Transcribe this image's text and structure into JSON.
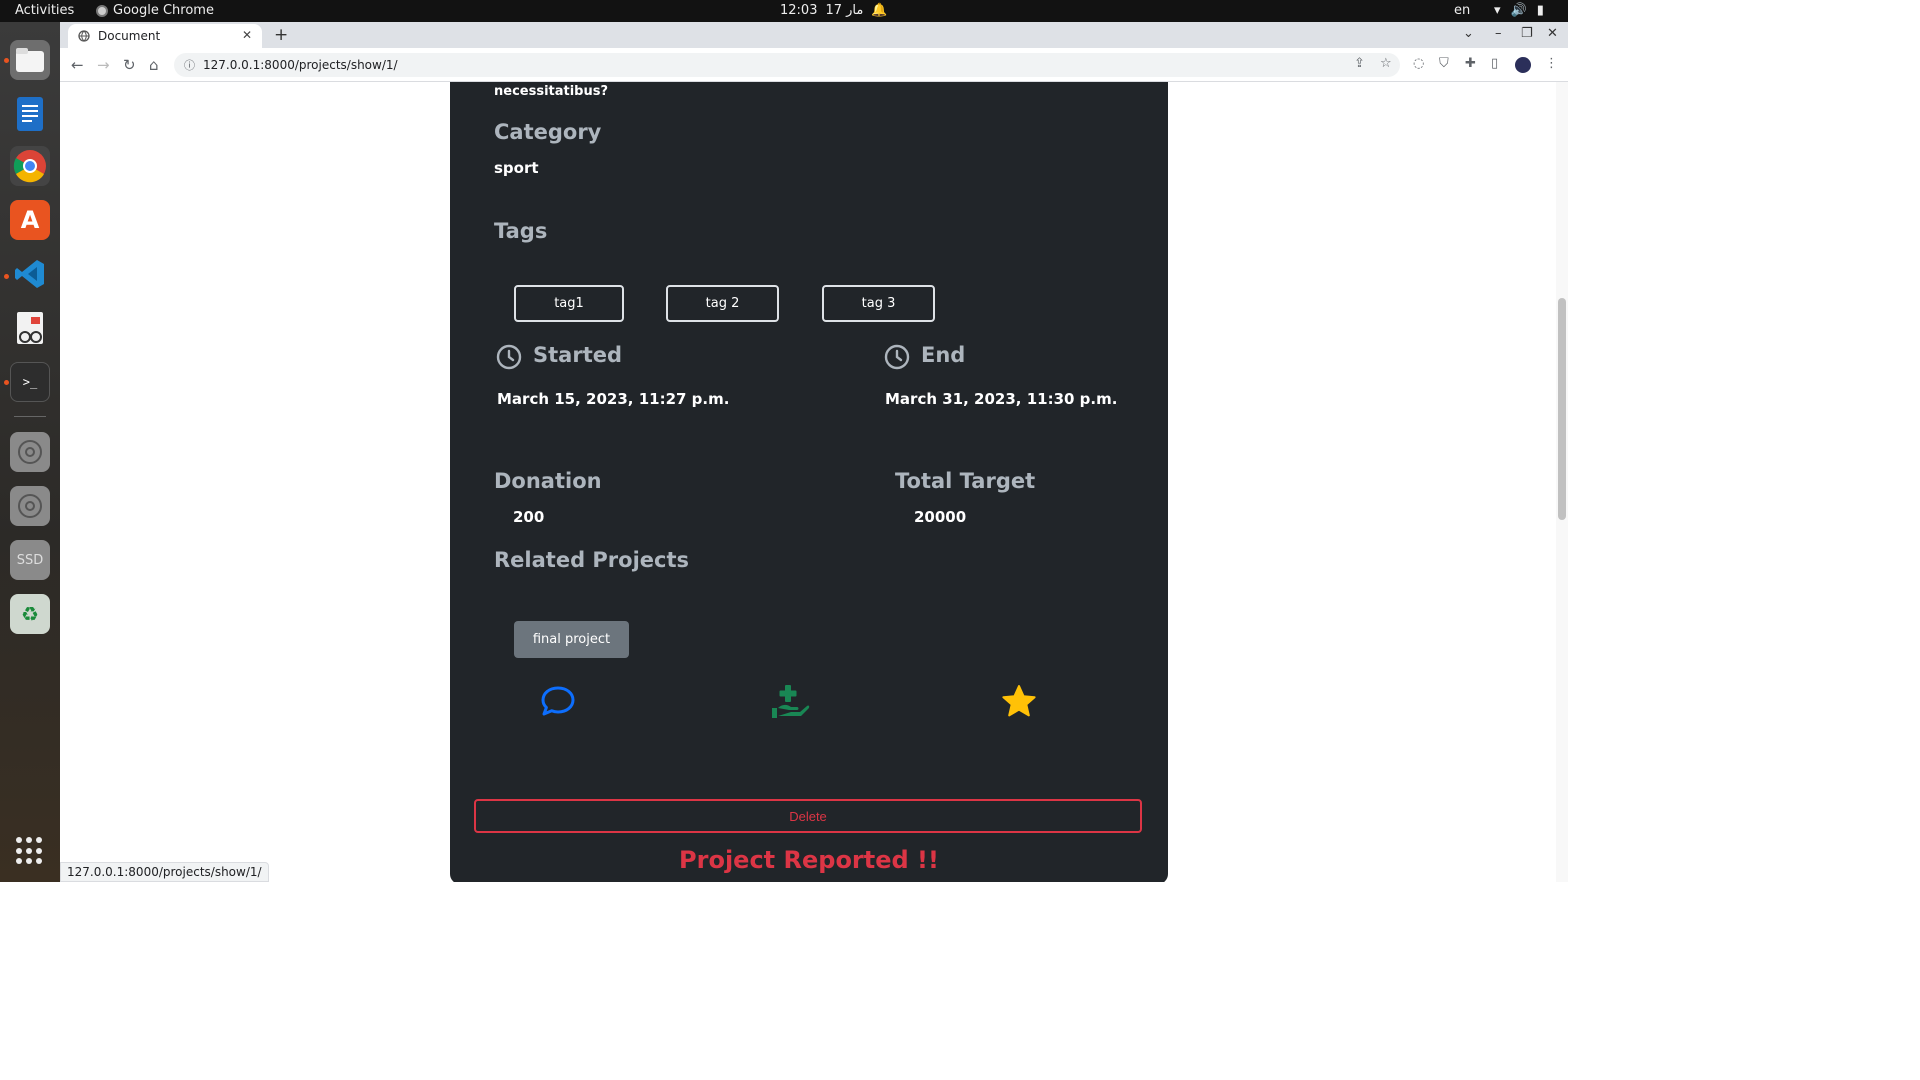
{
  "topbar": {
    "activities": "Activities",
    "app_name": "Google Chrome",
    "time": "12:03",
    "date": "17 مار",
    "lang": "en"
  },
  "browser": {
    "tab_title": "Document",
    "url": "127.0.0.1:8000/projects/show/1/",
    "status_url": "127.0.0.1:8000/projects/show/1/"
  },
  "project": {
    "description_tail": "necessitatibus?",
    "category_title": "Category",
    "category_value": "sport",
    "tags_title": "Tags",
    "tags": [
      "tag1",
      "tag 2",
      "tag 3"
    ],
    "started_title": "Started",
    "started_value": "March 15, 2023, 11:27 p.m.",
    "end_title": "End",
    "end_value": "March 31, 2023, 11:30 p.m.",
    "donation_title": "Donation",
    "donation_value": "200",
    "target_title": "Total Target",
    "target_value": "20000",
    "related_title": "Related Projects",
    "related": [
      "final project"
    ],
    "delete_label": "Delete",
    "reported_text": "Project Reported !!"
  },
  "colors": {
    "card_bg": "#212529",
    "muted_heading": "#adb5bd",
    "danger": "#dc3545",
    "comment_icon": "#0d6efd",
    "donate_icon": "#198754",
    "rate_icon": "#ffc107"
  },
  "icons": [
    "chat-bubble-icon",
    "hand-plus-donate-icon",
    "star-icon",
    "clock-icon"
  ]
}
